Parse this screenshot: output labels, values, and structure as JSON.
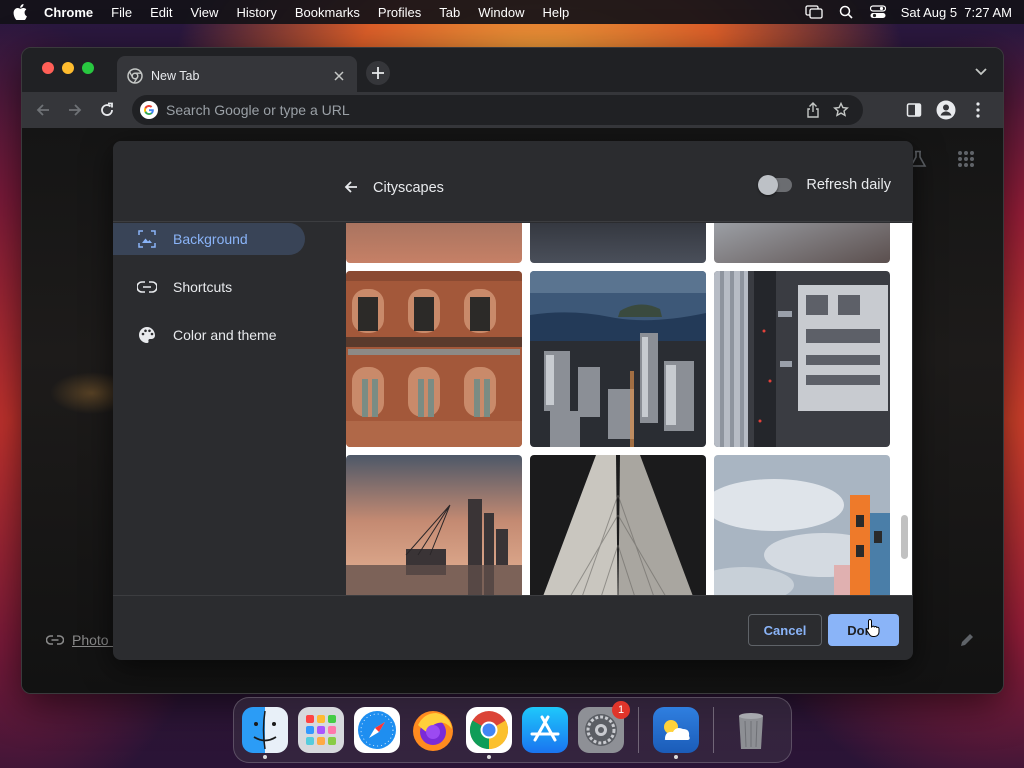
{
  "menubar": {
    "app_name": "Chrome",
    "items": [
      "File",
      "Edit",
      "View",
      "History",
      "Bookmarks",
      "Profiles",
      "Tab",
      "Window",
      "Help"
    ],
    "clock": "Sat Aug 5  7:27 AM"
  },
  "browser": {
    "tab_title": "New Tab",
    "omnibox_placeholder": "Search Google or type a URL"
  },
  "page": {
    "photo_credit": "Photo b"
  },
  "dialog": {
    "title": "Cityscapes",
    "refresh_label": "Refresh daily",
    "refresh_on": false,
    "sidebar": [
      {
        "label": "Background",
        "icon": "image-icon",
        "active": true
      },
      {
        "label": "Shortcuts",
        "icon": "link-icon",
        "active": false
      },
      {
        "label": "Color and theme",
        "icon": "palette-icon",
        "active": false
      }
    ],
    "cancel_label": "Cancel",
    "done_label": "Done"
  },
  "dock": {
    "apps": [
      {
        "name": "Finder",
        "icon": "finder-icon"
      },
      {
        "name": "Launchpad",
        "icon": "launchpad-icon"
      },
      {
        "name": "Safari",
        "icon": "safari-icon"
      },
      {
        "name": "Firefox",
        "icon": "firefox-icon"
      },
      {
        "name": "Chrome",
        "icon": "chrome-icon"
      },
      {
        "name": "App Store",
        "icon": "appstore-icon"
      },
      {
        "name": "System Settings",
        "icon": "settings-icon",
        "badge": "1"
      },
      {
        "name": "Weather",
        "icon": "weather-icon"
      },
      {
        "name": "Trash",
        "icon": "trash-icon"
      }
    ]
  },
  "colors": {
    "accent": "#8ab4f8",
    "dialog_bg": "#2b2c2f",
    "active_item_bg": "#394457"
  }
}
